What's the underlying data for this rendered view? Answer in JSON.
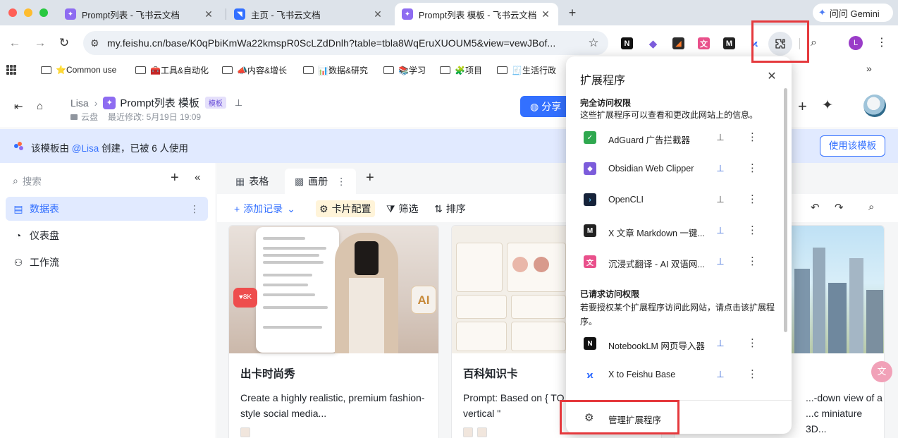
{
  "browser": {
    "tabs": [
      {
        "title": "Prompt列表 - 飞书云文档",
        "active": false
      },
      {
        "title": "主页 - 飞书云文档",
        "active": false
      },
      {
        "title": "Prompt列表 模板 - 飞书云文档",
        "active": true
      }
    ],
    "gemini_label": "问问 Gemini",
    "url": "my.feishu.cn/base/K0qPbiKmWa22kmspR0ScLZdDnlh?table=tbla8WqEruXUOUM5&view=vewJBof...",
    "profile_initial": "L",
    "bookmarks": [
      "⭐Common use",
      "🧰工具&自动化",
      "📣内容&增长",
      "📊数据&研究",
      "📚学习",
      "🧩项目",
      "🧾生活行政"
    ]
  },
  "feishu": {
    "breadcrumb_owner": "Lisa",
    "doc_title": "Prompt列表 模板",
    "badge": "模板",
    "location": "云盘",
    "modified": "最近修改: 5月19日 19:09",
    "share_label": "分享",
    "banner": {
      "prefix": "该模板由 ",
      "mention": "@Lisa",
      "suffix": " 创建，已被 6 人使用",
      "button": "使用该模板"
    },
    "sidebar": {
      "search_placeholder": "搜索",
      "items": [
        {
          "label": "数据表",
          "icon": "table-icon",
          "active": true
        },
        {
          "label": "仪表盘",
          "icon": "dashboard-icon",
          "active": false
        },
        {
          "label": "工作流",
          "icon": "workflow-icon",
          "active": false
        }
      ]
    },
    "views": [
      {
        "label": "表格",
        "icon": "grid-view-icon",
        "active": false
      },
      {
        "label": "画册",
        "icon": "gallery-view-icon",
        "active": true
      }
    ],
    "actions": {
      "add_record": "添加记录",
      "card_config": "卡片配置",
      "filter": "筛选",
      "sort": "排序"
    },
    "cards": [
      {
        "title": "出卡时尚秀",
        "desc": "Create a highly realistic, premium fashion-style social media..."
      },
      {
        "title": "百科知识卡",
        "desc": "Prompt: Based on { TO... high-quality vertical \""
      },
      {
        "title": "",
        "desc": "...-down view of a ...c miniature 3D..."
      }
    ],
    "card_images": {
      "fashion_like": "♥8K",
      "fashion_ai": "AI"
    }
  },
  "extensions_popup": {
    "title": "扩展程序",
    "full_access_title": "完全访问权限",
    "full_access_desc": "这些扩展程序可以查看和更改此网站上的信息。",
    "full_access": [
      {
        "name": "AdGuard 广告拦截器",
        "pinned": true,
        "icon_color": "#2fa84f",
        "glyph": "✓"
      },
      {
        "name": "Obsidian Web Clipper",
        "pinned": false,
        "icon_color": "#7c5cdb",
        "glyph": "◆"
      },
      {
        "name": "OpenCLI",
        "pinned": true,
        "icon_color": "#16233a",
        "glyph": "›"
      },
      {
        "name": "X 文章 Markdown 一键...",
        "pinned": false,
        "icon_color": "#222222",
        "glyph": "M"
      },
      {
        "name": "沉浸式翻译 - AI 双语网...",
        "pinned": false,
        "icon_color": "#e9508b",
        "glyph": "文"
      }
    ],
    "requested_title": "已请求访问权限",
    "requested_desc": "若要授权某个扩展程序访问此网站，请点击该扩展程序。",
    "requested": [
      {
        "name": "NotebookLM 网页导入器",
        "pinned": false,
        "icon_color": "#111111",
        "glyph": "N"
      },
      {
        "name": "X to Feishu Base",
        "pinned": false,
        "icon_color": "#2f6bff",
        "glyph": "ϰ"
      }
    ],
    "manage_label": "管理扩展程序"
  }
}
